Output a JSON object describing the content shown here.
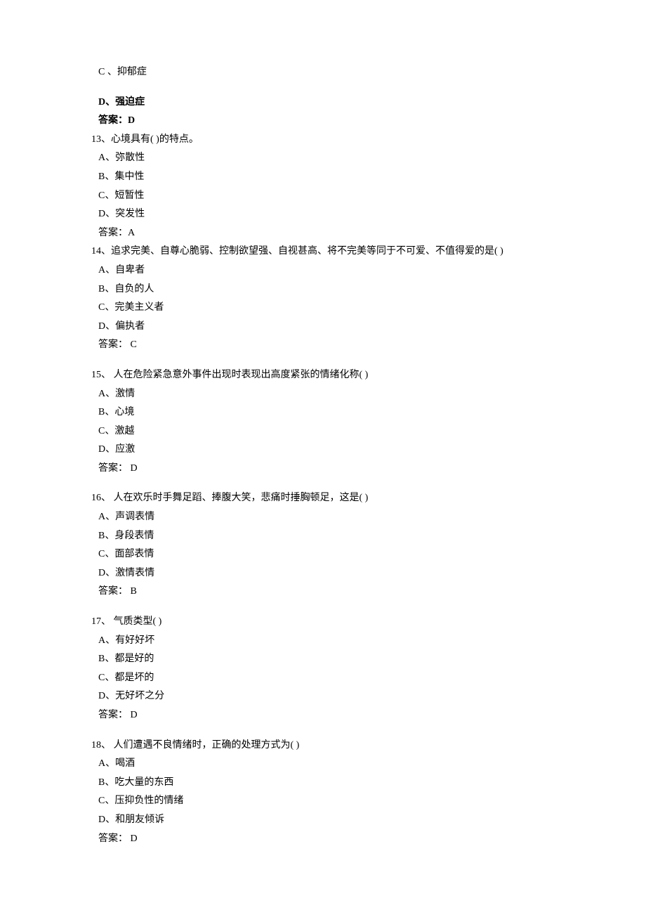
{
  "q12": {
    "optC": "C 、抑郁症",
    "optD": "D、强迫症",
    "answer": "答案：D"
  },
  "q13": {
    "stem": "13、心境具有( )的特点。",
    "optA": "A、弥散性",
    "optB": "B、集中性",
    "optC": "C、短暂性",
    "optD": "D、突发性",
    "answer": "答案：A"
  },
  "q14": {
    "stem": "14、追求完美、自尊心脆弱、控制欲望强、自视甚高、将不完美等同于不可爱、不值得爱的是( )",
    "optA": "A、自卑者",
    "optB": "B、自负的人",
    "optC": "C、完美主义者",
    "optD": "D、偏执者",
    "answer": "答案： C"
  },
  "q15": {
    "stem": "15、 人在危险紧急意外事件出现时表现出高度紧张的情绪化称( )",
    "optA": "A、激情",
    "optB": "B、心境",
    "optC": "C、激越",
    "optD": "D、应激",
    "answer": "答案： D"
  },
  "q16": {
    "stem": "16、 人在欢乐时手舞足蹈、捧腹大笑，悲痛时捶胸顿足，这是( )",
    "optA": "A、声调表情",
    "optB": "B、身段表情",
    "optC": "C、面部表情",
    "optD": "D、激情表情",
    "answer": "答案： B"
  },
  "q17": {
    "stem": "17、 气质类型( )",
    "optA": "A、有好好坏",
    "optB": "B、都是好的",
    "optC": "C、都是坏的",
    "optD": "D、无好坏之分",
    "answer": "答案： D"
  },
  "q18": {
    "stem": "18、 人们遭遇不良情绪时，正确的处理方式为(  )",
    "optA": "A、喝酒",
    "optB": "B、吃大量的东西",
    "optC": "C、压抑负性的情绪",
    "optD": "D、和朋友倾诉",
    "answer": "答案： D"
  }
}
